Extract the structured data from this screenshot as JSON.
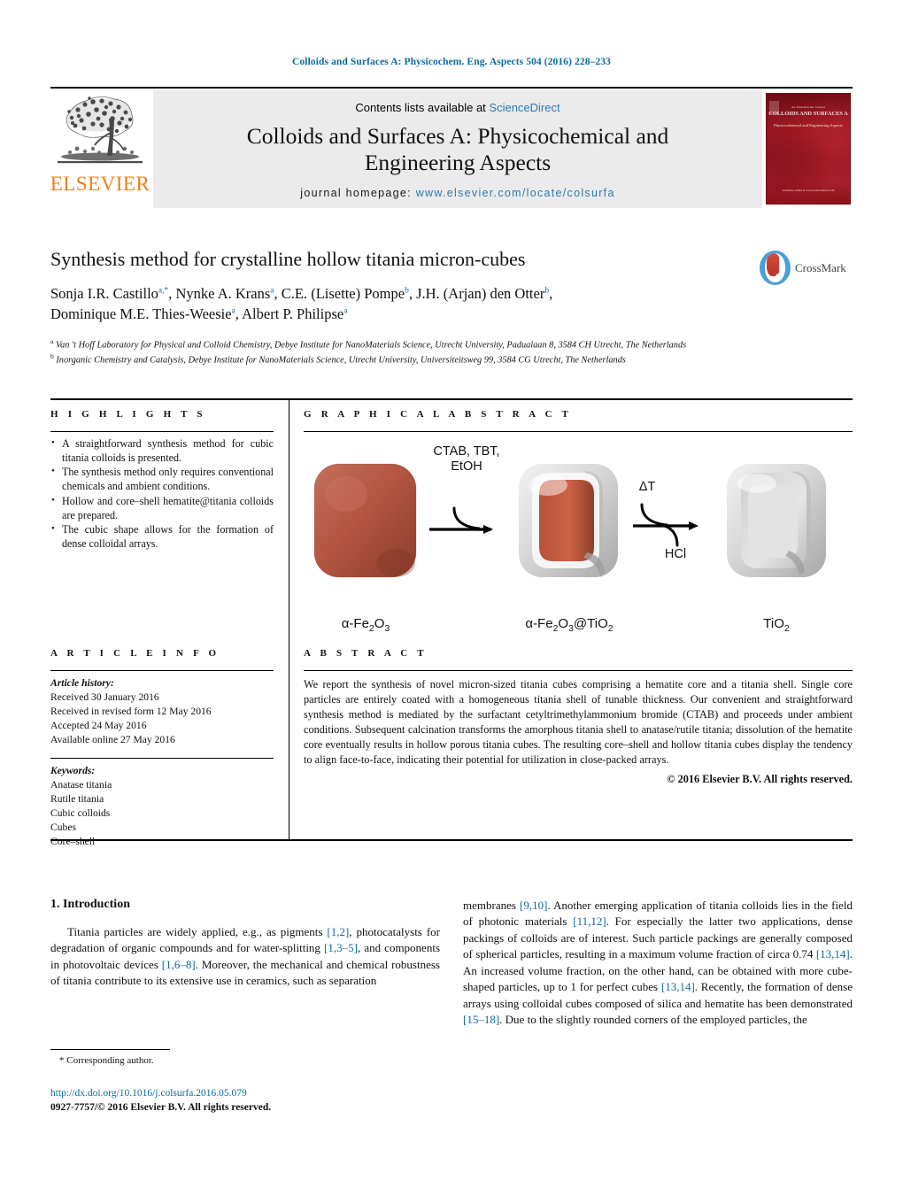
{
  "running_head": "Colloids and Surfaces A: Physicochem. Eng. Aspects 504 (2016) 228–233",
  "masthead": {
    "contents_prefix": "Contents lists available at ",
    "sciencedirect": "ScienceDirect",
    "journal_title_line1": "Colloids and Surfaces A: Physicochemical and",
    "journal_title_line2": "Engineering Aspects",
    "homepage_prefix": "journal homepage: ",
    "homepage_url": "www.elsevier.com/locate/colsurfa",
    "publisher_wordmark": "ELSEVIER",
    "publisher_logo_icon": "elsevier-tree-icon",
    "cover": {
      "line1": "An International Journal",
      "line2": "COLLOIDS AND SURFACES A",
      "line3": "Physicochemical and Engineering Aspects",
      "line4": "Available online at www.sciencedirect.com"
    }
  },
  "article": {
    "title": "Synthesis method for crystalline hollow titania micron-cubes",
    "crossmark_label": "CrossMark",
    "authors_line1": "Sonja I.R. Castillo",
    "authors": [
      {
        "name": "Sonja I.R. Castillo",
        "marks": "a,*"
      },
      {
        "name": "Nynke A. Krans",
        "marks": "a"
      },
      {
        "name": "C.E. (Lisette) Pompe",
        "marks": "b"
      },
      {
        "name": "J.H. (Arjan) den Otter",
        "marks": "b"
      },
      {
        "name": "Dominique M.E. Thies-Weesie",
        "marks": "a"
      },
      {
        "name": "Albert P. Philipse",
        "marks": "a"
      }
    ],
    "affiliations": [
      {
        "mark": "a",
        "text": "Van 't Hoff Laboratory for Physical and Colloid Chemistry, Debye Institute for NanoMaterials Science, Utrecht University, Padualaan 8, 3584 CH Utrecht, The Netherlands"
      },
      {
        "mark": "b",
        "text": "Inorganic Chemistry and Catalysis, Debye Institute for NanoMaterials Science, Utrecht University, Universiteitsweg 99, 3584 CG Utrecht, The Netherlands"
      }
    ]
  },
  "highlights": {
    "heading": "H I G H L I G H T S",
    "items": [
      "A straightforward synthesis method for cubic titania colloids is presented.",
      "The synthesis method only requires conventional chemicals and ambient conditions.",
      "Hollow and core–shell hematite@titania colloids are prepared.",
      "The cubic shape allows for the formation of dense colloidal arrays."
    ]
  },
  "graphical_abstract": {
    "heading": "G R A P H I C A L   A B S T R A C T",
    "particles": [
      {
        "id": "hematite-cube",
        "label_html": "α-Fe<sub>2</sub>O<sub>3</sub>",
        "type": "solid",
        "color": "#b35642"
      },
      {
        "id": "core-shell-cube",
        "label_html": "α-Fe<sub>2</sub>O<sub>3</sub>@TiO<sub>2</sub>",
        "type": "core-shell",
        "core_color": "#c75c3f",
        "shell_color": "#d9d9d9"
      },
      {
        "id": "hollow-cube",
        "label_html": "TiO<sub>2</sub>",
        "type": "hollow",
        "shell_color": "#dcdcdc"
      }
    ],
    "arrow1_above": "CTAB, TBT,\nEtOH",
    "arrow1_above_l1": "CTAB, TBT,",
    "arrow1_above_l2": "EtOH",
    "arrow2_above": "ΔT",
    "arrow2_below": "HCl"
  },
  "article_info": {
    "heading": "A R T I C L E   I N F O",
    "history_label": "Article history:",
    "history": [
      "Received 30 January 2016",
      "Received in revised form 12 May 2016",
      "Accepted 24 May 2016",
      "Available online 27 May 2016"
    ],
    "keywords_label": "Keywords:",
    "keywords": [
      "Anatase titania",
      "Rutile titania",
      "Cubic colloids",
      "Cubes",
      "Core–shell"
    ]
  },
  "abstract": {
    "heading": "A B S T R A C T",
    "text": "We report the synthesis of novel micron-sized titania cubes comprising a hematite core and a titania shell. Single core particles are entirely coated with a homogeneous titania shell of tunable thickness. Our convenient and straightforward synthesis method is mediated by the surfactant cetyltrimethylammonium bromide (CTAB) and proceeds under ambient conditions. Subsequent calcination transforms the amorphous titania shell to anatase/rutile titania; dissolution of the hematite core eventually results in hollow porous titania cubes. The resulting core–shell and hollow titania cubes display the tendency to align face-to-face, indicating their potential for utilization in close-packed arrays.",
    "copyright": "© 2016 Elsevier B.V. All rights reserved."
  },
  "body": {
    "section_title": "1.  Introduction",
    "left_paragraph": "Titania particles are widely applied, e.g., as pigments [1,2], photocatalysts for degradation of organic compounds and for water-splitting [1,3–5], and components in photovoltaic devices [1,6–8]. Moreover, the mechanical and chemical robustness of titania contribute to its extensive use in ceramics, such as separation",
    "right_paragraph": "membranes [9,10]. Another emerging application of titania colloids lies in the field of photonic materials [11,12]. For especially the latter two applications, dense packings of colloids are of interest. Such particle packings are generally composed of spherical particles, resulting in a maximum volume fraction of circa 0.74 [13,14]. An increased volume fraction, on the other hand, can be obtained with more cube-shaped particles, up to 1 for perfect cubes [13,14]. Recently, the formation of dense arrays using colloidal cubes composed of silica and hematite has been demonstrated [15–18]. Due to the slightly rounded corners of the employed particles, the"
  },
  "footer": {
    "corresponding_author": "* Corresponding author.",
    "doi": "http://dx.doi.org/10.1016/j.colsurfa.2016.05.079",
    "issn_line": "0927-7757/© 2016 Elsevier B.V. All rights reserved."
  },
  "colors": {
    "link": "#0b6ba0",
    "elsevier_orange": "#ef7f1a",
    "hematite": "#b35642",
    "cover_red": "#8d1018"
  }
}
